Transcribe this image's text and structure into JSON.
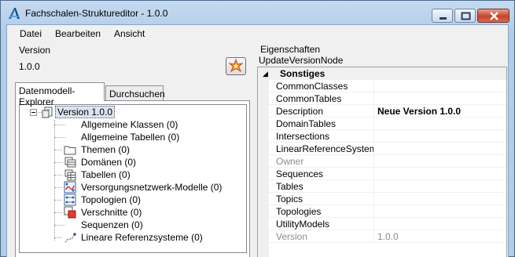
{
  "window": {
    "title": "Fachschalen-Strukturedit​or - 1.0.0",
    "app_icon": "autodesk-logo-icon"
  },
  "menu": [
    "Datei",
    "Bearbeiten",
    "Ansicht"
  ],
  "version_section": {
    "label": "Version",
    "value": "1.0.0",
    "star_icon": "new-version-star-icon"
  },
  "tabs": [
    "Datenmodell-Explorer",
    "Durchsuchen"
  ],
  "tree": {
    "root": "Version 1.0.0",
    "items": [
      {
        "label": "Allgemeine Klassen (0)",
        "icon": "none"
      },
      {
        "label": "Allgemeine Tabellen (0)",
        "icon": "none"
      },
      {
        "label": "Themen (0)",
        "icon": "folder-icon"
      },
      {
        "label": "Domänen (0)",
        "icon": "domain-table-icon"
      },
      {
        "label": "Tabellen (0)",
        "icon": "table-icon"
      },
      {
        "label": "Versorgungsnetzwerk-Modelle (0)",
        "icon": "utility-network-icon"
      },
      {
        "label": "Topologien (0)",
        "icon": "topology-icon"
      },
      {
        "label": "Verschnitte (0)",
        "icon": "intersection-icon"
      },
      {
        "label": "Sequenzen (0)",
        "icon": "none"
      },
      {
        "label": "Lineare Referenzsysteme (0)",
        "icon": "linear-reference-icon"
      }
    ]
  },
  "properties": {
    "title": "Eigenschaften",
    "object": "UpdateVersionNode",
    "category": "Sonstiges",
    "rows": [
      {
        "name": "CommonClasses",
        "value": "",
        "dim": false
      },
      {
        "name": "CommonTables",
        "value": "",
        "dim": false
      },
      {
        "name": "Description",
        "value": "Neue Version 1.0.0",
        "dim": false,
        "bold": true
      },
      {
        "name": "DomainTables",
        "value": "",
        "dim": false
      },
      {
        "name": "Intersections",
        "value": "",
        "dim": false
      },
      {
        "name": "LinearReferenceSystems",
        "value": "",
        "dim": false
      },
      {
        "name": "Owner",
        "value": "",
        "dim": true
      },
      {
        "name": "Sequences",
        "value": "",
        "dim": false
      },
      {
        "name": "Tables",
        "value": "",
        "dim": false
      },
      {
        "name": "Topics",
        "value": "",
        "dim": false
      },
      {
        "name": "Topologies",
        "value": "",
        "dim": false
      },
      {
        "name": "UtilityModels",
        "value": "",
        "dim": false
      },
      {
        "name": "Version",
        "value": "1.0.0",
        "dim": true
      }
    ]
  }
}
